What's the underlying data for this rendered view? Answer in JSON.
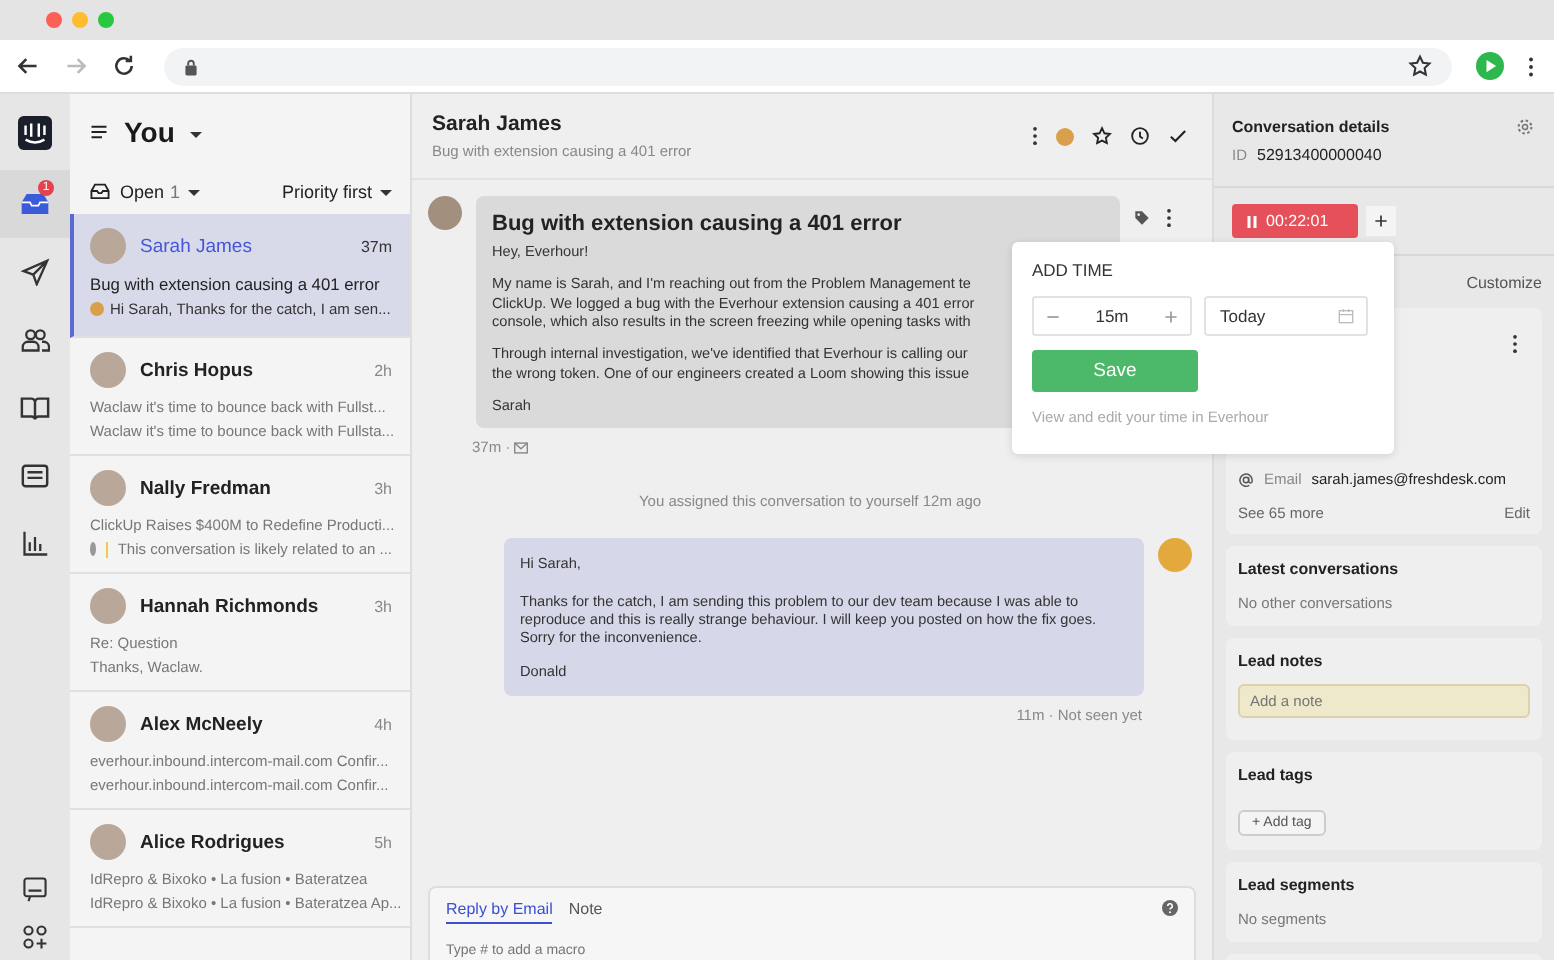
{
  "browser": {
    "nav": [
      {
        "kind": "back",
        "disabled": false
      },
      {
        "kind": "forward",
        "disabled": true
      },
      {
        "kind": "reload",
        "disabled": false
      }
    ]
  },
  "rail": {
    "items": [
      {
        "kind": "inbox",
        "selected": true,
        "badge": "1"
      },
      {
        "kind": "send",
        "selected": false
      },
      {
        "kind": "people",
        "selected": false
      },
      {
        "kind": "book",
        "selected": false
      },
      {
        "kind": "card",
        "selected": false
      },
      {
        "kind": "chart",
        "selected": false
      }
    ],
    "bottom": [
      {
        "kind": "chat"
      },
      {
        "kind": "apps"
      }
    ]
  },
  "inbox": {
    "title": "You",
    "filter": {
      "label": "Open",
      "count": "1"
    },
    "sort": "Priority first",
    "conversations": [
      {
        "name": "Sarah James",
        "time": "37m",
        "selected": true,
        "line_1": "Bug with extension causing a 401 error",
        "line_2": "Hi Sarah,  Thanks for the catch, I am sen...",
        "preview_mark": {
          "kind": "avatar"
        }
      },
      {
        "name": "Chris Hopus",
        "time": "2h",
        "selected": false,
        "line_1": "Waclaw it's time to bounce back with Fullst...",
        "line_2": "Waclaw it's time to bounce back with Fullsta..."
      },
      {
        "name": "Nally Fredman",
        "time": "3h",
        "selected": false,
        "line_1": "ClickUp Raises $400M to Redefine Producti...",
        "line_2": "This conversation is likely related to an ...",
        "preview_mark": {
          "kind": "note"
        }
      },
      {
        "name": "Hannah Richmonds",
        "time": "3h",
        "selected": false,
        "line_1": "Re: Question",
        "line_2": "Thanks, Waclaw."
      },
      {
        "name": "Alex McNeely",
        "time": "4h",
        "selected": false,
        "line_1": "everhour.inbound.intercom-mail.com Confir...",
        "line_2": "everhour.inbound.intercom-mail.com Confir..."
      },
      {
        "name": "Alice Rodrigues",
        "time": "5h",
        "selected": false,
        "line_1": "IdRepro & Bixoko • La fusion • Bateratzea",
        "line_2": "IdRepro & Bixoko • La fusion • Bateratzea Ap..."
      }
    ]
  },
  "conversation": {
    "name": "Sarah James",
    "subject": "Bug with extension causing a 401 error",
    "messages": [
      {
        "kind": "incoming",
        "title": "Bug with extension causing a 401 error",
        "paragraphs": [
          [
            "Hey, Everhour!"
          ],
          [
            "My name is Sarah, and I'm reaching out from the Problem Management te",
            "ClickUp. We logged a bug with the Everhour extension causing a 401 error",
            "console, which also results in the screen freezing while opening tasks with"
          ],
          [
            "Through internal investigation, we've identified that Everhour is calling our",
            "the wrong token. One of our engineers created a Loom showing this issue"
          ],
          [
            "Sarah"
          ]
        ],
        "meta": "37m ·"
      },
      {
        "kind": "event",
        "text": "You assigned this conversation to yourself 12m ago"
      },
      {
        "kind": "outgoing",
        "paragraphs": [
          [
            "Hi Sarah,"
          ],
          [
            "Thanks for the catch, I am sending this problem to our dev team because I was able to reproduce and this is really strange behaviour. I will keep you posted on how the fix goes. Sorry for the inconvenience."
          ],
          [
            "Donald"
          ]
        ],
        "meta": "11m · Not seen yet"
      }
    ],
    "reply": {
      "tabs": [
        {
          "label": "Reply by Email",
          "selected": true
        },
        {
          "label": "Note",
          "selected": false
        }
      ],
      "placeholder": "Type # to add a macro"
    }
  },
  "add_time": {
    "title": "ADD TIME",
    "duration": "15m",
    "date": "Today",
    "save": "Save",
    "footer": "View and edit your time in Everhour"
  },
  "details": {
    "title": "Conversation details",
    "id_label": "ID",
    "id": "52913400000040",
    "timer": "00:22:01",
    "customize": "Customize",
    "email_label": "Email",
    "email": "sarah.james@freshdesk.com",
    "see_more": "See 65 more",
    "edit": "Edit",
    "sections": [
      {
        "kind": "text",
        "title": "Latest conversations",
        "text": "No other conversations"
      },
      {
        "kind": "note",
        "title": "Lead notes",
        "placeholder": "Add a note"
      },
      {
        "kind": "tag",
        "title": "Lead tags",
        "button": "+ Add tag"
      },
      {
        "kind": "text",
        "title": "Lead segments",
        "text": "No segments"
      }
    ]
  }
}
